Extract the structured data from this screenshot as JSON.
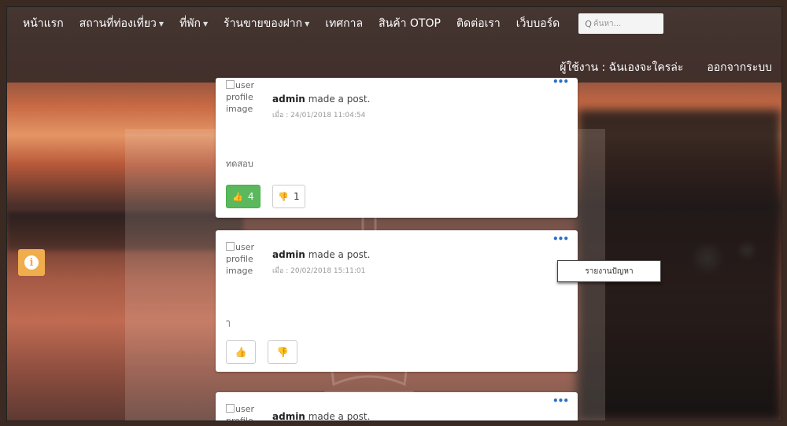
{
  "nav": {
    "items": [
      {
        "label": "หน้าแรก",
        "dropdown": false
      },
      {
        "label": "สถานที่ท่องเที่ยว",
        "dropdown": true
      },
      {
        "label": "ที่พัก",
        "dropdown": true
      },
      {
        "label": "ร้านขายของฝาก",
        "dropdown": true
      },
      {
        "label": "เทศกาล",
        "dropdown": false
      },
      {
        "label": "สินค้า OTOP",
        "dropdown": false
      },
      {
        "label": "ติดต่อเรา",
        "dropdown": false
      },
      {
        "label": "เว็บบอร์ด",
        "dropdown": false
      }
    ],
    "search_placeholder": "ค้นหา...",
    "user_label": "ผู้ใช้งาน : ฉันเองจะใครล่ะ",
    "logout_label": "ออกจากระบบ"
  },
  "colors": {
    "like_active": "#5cb85c",
    "info_button": "#f0ad4e",
    "menu_dots": "#2b6fc4"
  },
  "posts": [
    {
      "avatar_alt": [
        "user",
        "profile",
        "image"
      ],
      "author": "admin",
      "action": "made a post.",
      "date": "เมื่อ : 24/01/2018 11:04:54",
      "content": "ทดสอบ",
      "likes": "4",
      "dislikes": "1",
      "liked": true
    },
    {
      "avatar_alt": [
        "user",
        "profile",
        "image"
      ],
      "author": "admin",
      "action": "made a post.",
      "date": "เมื่อ : 20/02/2018 15:11:01",
      "content": "ๅ",
      "likes": "",
      "dislikes": "",
      "liked": false
    },
    {
      "avatar_alt": [
        "user",
        "profile"
      ],
      "author": "admin",
      "action": "made a post."
    }
  ],
  "post_menu": {
    "report_label": "รายงานปัญหา"
  },
  "icons": {
    "menu": "ellipsis-icon",
    "like": "thumbs-up-icon",
    "dislike": "thumbs-down-icon",
    "info": "info-icon",
    "search": "search-icon"
  }
}
